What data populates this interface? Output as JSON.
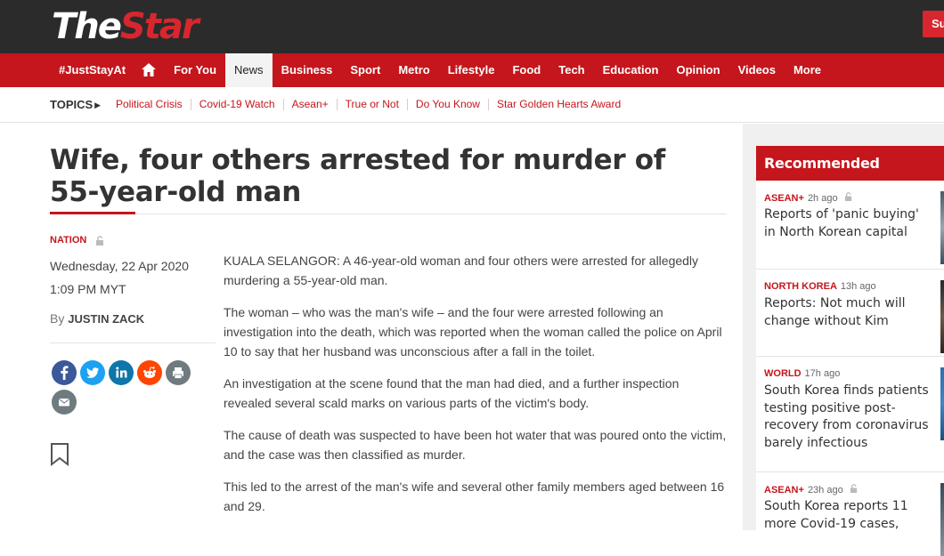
{
  "header": {
    "logo_the": "The",
    "logo_star": "Star",
    "subscribe": "Su"
  },
  "nav": {
    "items": [
      "#JustStayAt",
      "home",
      "For You",
      "News",
      "Business",
      "Sport",
      "Metro",
      "Lifestyle",
      "Food",
      "Tech",
      "Education",
      "Opinion",
      "Videos",
      "More"
    ],
    "active": "News"
  },
  "topics": {
    "label": "TOPICS",
    "items": [
      "Political Crisis",
      "Covid-19 Watch",
      "Asean+",
      "True or Not",
      "Do You Know",
      "Star Golden Hearts Award"
    ]
  },
  "article": {
    "headline": "Wife, four others arrested for murder of 55-year-old man",
    "category": "NATION",
    "date": "Wednesday, 22 Apr 2020",
    "time": "1:09 PM MYT",
    "by": "By",
    "author": "JUSTIN ZACK",
    "paragraphs": [
      "KUALA SELANGOR: A 46-year-old woman and four others were arrested for allegedly murdering a 55-year-old man.",
      "The woman – who was the man's wife – and the four were arrested following an investigation into the death, which was reported when the woman called the police on April 10 to say that her husband was unconscious after a fall in the toilet.",
      "An investigation at the scene found that the man had died, and a further inspection revealed several scald marks on various parts of the victim's body.",
      "The cause of death was suspected to have been hot water that was poured onto the victim, and the case was then classified as murder.",
      "This led to the arrest of the man's wife and several other family members aged between 16 and 29."
    ]
  },
  "share": {
    "facebook": "f",
    "twitter": "t",
    "linkedin": "in",
    "reddit": "r",
    "print": "p",
    "email": "e"
  },
  "sidebar": {
    "title": "Recommended Reading",
    "items": [
      {
        "category": "ASEAN+",
        "time": "2h ago",
        "title": "Reports of 'panic buying' in North Korean capital"
      },
      {
        "category": "NORTH KOREA",
        "time": "13h ago",
        "title": "Reports: Not much will change without Kim"
      },
      {
        "category": "WORLD",
        "time": "17h ago",
        "title": "South Korea finds patients testing positive post-recovery from coronavirus barely infectious"
      },
      {
        "category": "ASEAN+",
        "time": "23h ago",
        "title": "South Korea reports 11 more Covid-19 cases,"
      }
    ]
  },
  "colors": {
    "brand_red": "#c4161c",
    "topbar": "#2b2b2b"
  }
}
